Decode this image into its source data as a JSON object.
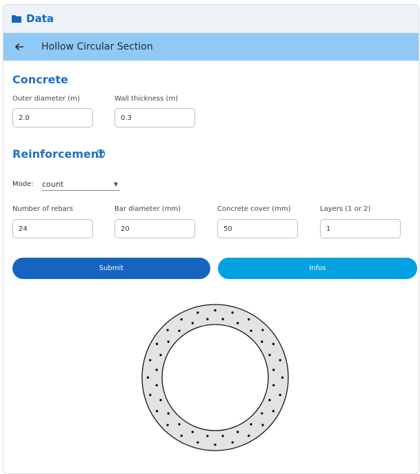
{
  "header": {
    "icon": "folder-icon",
    "title": "Data"
  },
  "subheader": {
    "icon": "back-arrow-icon",
    "title": "Hollow Circular Section"
  },
  "concrete": {
    "heading": "Concrete",
    "outer_diameter": {
      "label": "Outer diameter (m)",
      "value": "2.0"
    },
    "wall_thickness": {
      "label": "Wall thickness (m)",
      "value": "0.3"
    }
  },
  "reinforcement": {
    "heading": "Reinforcement",
    "help_icon": "help-circle-icon",
    "mode": {
      "label": "Mode:",
      "value": "count"
    },
    "number_of_rebars": {
      "label": "Number of rebars",
      "value": "24"
    },
    "bar_diameter": {
      "label": "Bar diameter (mm)",
      "value": "20"
    },
    "concrete_cover": {
      "label": "Concrete cover (mm)",
      "value": "50"
    },
    "layers": {
      "label": "Layers (1 or 2)",
      "value": "1"
    }
  },
  "buttons": {
    "submit": "Submit",
    "infos": "Infos"
  },
  "colors": {
    "primary": "#1565c0",
    "accent": "#03a0e2",
    "subbar": "#90c9f5",
    "section_fill": "#e3e3e3"
  }
}
